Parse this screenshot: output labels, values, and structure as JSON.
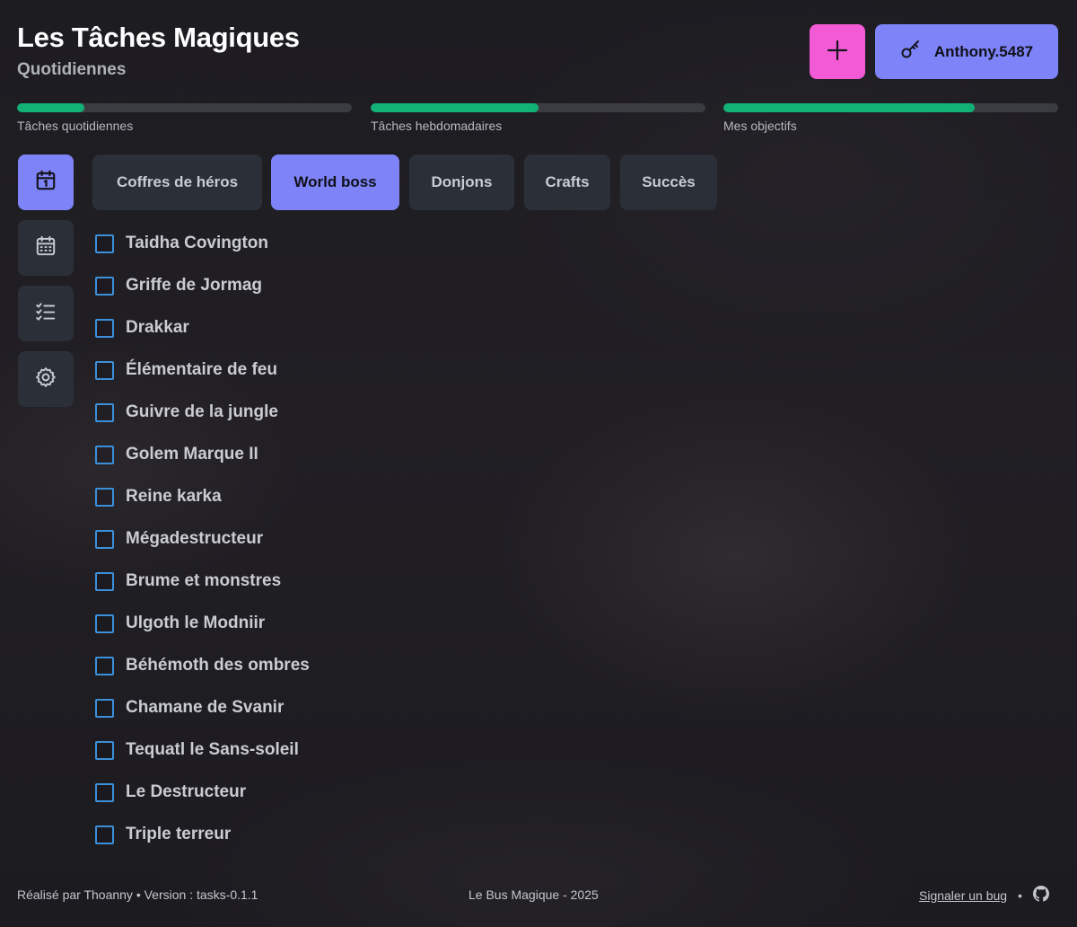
{
  "header": {
    "title": "Les Tâches Magiques",
    "subtitle": "Quotidiennes",
    "add_button_icon": "plus-icon",
    "user_button_icon": "key-icon",
    "user_name": "Anthony.5487"
  },
  "progress": [
    {
      "label": "Tâches quotidiennes",
      "fill": 0.2
    },
    {
      "label": "Tâches hebdomadaires",
      "fill": 0.5
    },
    {
      "label": "Mes objectifs",
      "fill": 0.75
    }
  ],
  "sidebar": {
    "items": [
      {
        "icon": "calendar-day-icon",
        "active": true
      },
      {
        "icon": "calendar-week-icon",
        "active": false
      },
      {
        "icon": "checklist-icon",
        "active": false
      },
      {
        "icon": "settings-gear-icon",
        "active": false
      }
    ]
  },
  "tabs": [
    {
      "label": "Coffres de héros",
      "active": false
    },
    {
      "label": "World boss",
      "active": true
    },
    {
      "label": "Donjons",
      "active": false
    },
    {
      "label": "Crafts",
      "active": false
    },
    {
      "label": "Succès",
      "active": false
    }
  ],
  "tasks": [
    {
      "label": "Taidha Covington",
      "checked": false
    },
    {
      "label": "Griffe de Jormag",
      "checked": false
    },
    {
      "label": "Drakkar",
      "checked": false
    },
    {
      "label": "Élémentaire de feu",
      "checked": false
    },
    {
      "label": "Guivre de la jungle",
      "checked": false
    },
    {
      "label": "Golem Marque II",
      "checked": false
    },
    {
      "label": "Reine karka",
      "checked": false
    },
    {
      "label": "Mégadestructeur",
      "checked": false
    },
    {
      "label": "Brume et monstres",
      "checked": false
    },
    {
      "label": "Ulgoth le Modniir",
      "checked": false
    },
    {
      "label": "Béhémoth des ombres",
      "checked": false
    },
    {
      "label": "Chamane de Svanir",
      "checked": false
    },
    {
      "label": "Tequatl le Sans-soleil",
      "checked": false
    },
    {
      "label": "Le Destructeur",
      "checked": false
    },
    {
      "label": "Triple terreur",
      "checked": false
    }
  ],
  "footer": {
    "credits": "Réalisé par Thoanny • Version : tasks-0.1.1",
    "center": "Le Bus Magique - 2025",
    "report_link": "Signaler un bug",
    "separator": "•",
    "github_icon": "github-icon"
  },
  "colors": {
    "accent": "#7e83f7",
    "add_button": "#f25ad6",
    "progress_fill": "#12b176",
    "checkbox_border": "#3c8fd9"
  }
}
